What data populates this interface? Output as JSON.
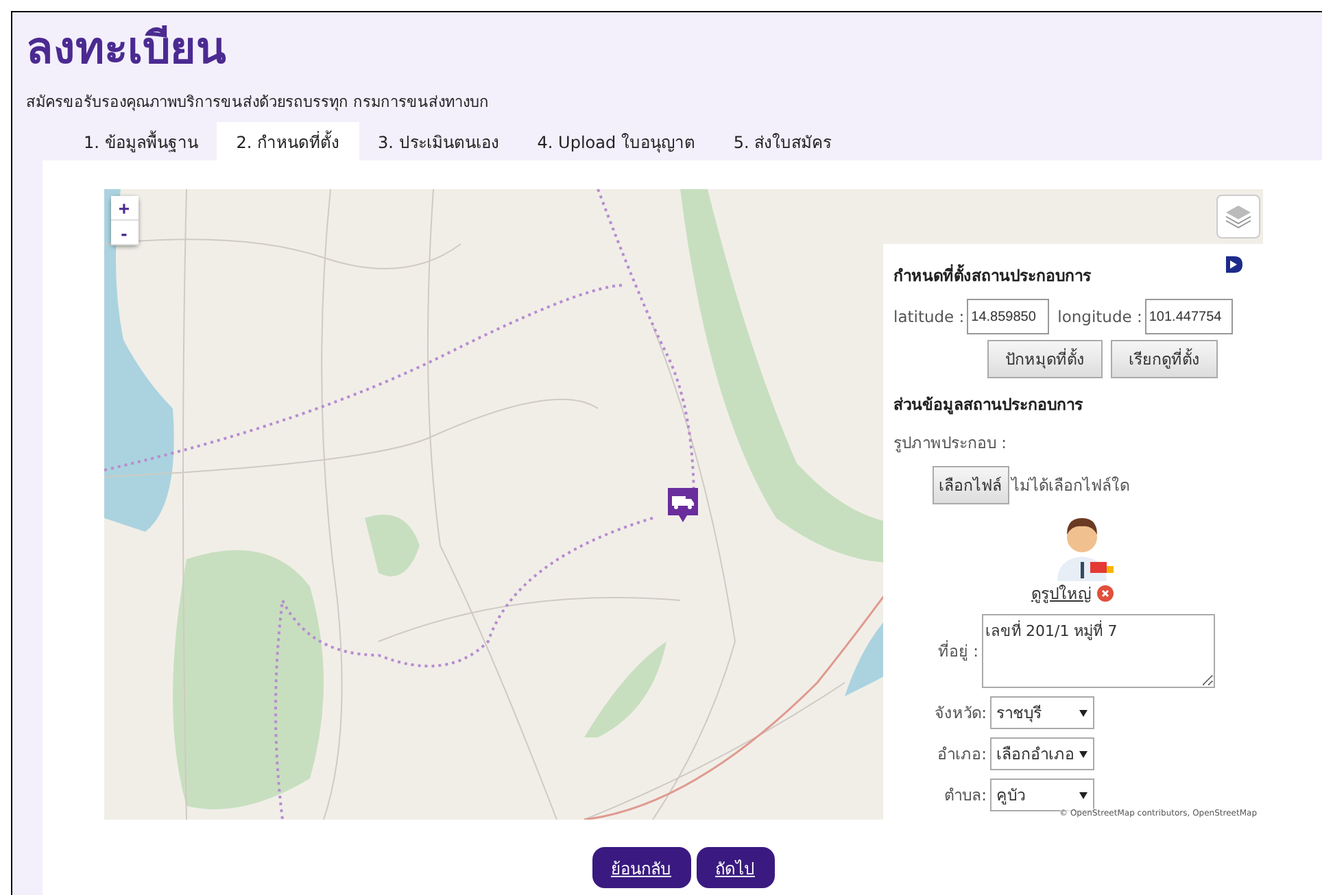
{
  "title": "ลงทะเบียน",
  "subtitle": "สมัครขอรับรองคุณภาพบริการขนส่งด้วยรถบรรทุก กรมการขนส่งทางบก",
  "tabs": [
    {
      "label": "1. ข้อมูลพื้นฐาน",
      "selected": false
    },
    {
      "label": "2. กำหนดที่ตั้ง",
      "selected": true
    },
    {
      "label": "3. ประเมินตนเอง",
      "selected": false
    },
    {
      "label": "4. Upload ใบอนุญาต",
      "selected": false
    },
    {
      "label": "5. ส่งใบสมัคร",
      "selected": false
    }
  ],
  "map": {
    "zoom_in": "+",
    "zoom_out": "-",
    "attribution": "© OpenStreetMap contributors, OpenStreetMap"
  },
  "panel": {
    "heading": "กำหนดที่ตั้งสถานประกอบการ",
    "latitude": {
      "label": "latitude :",
      "value": "14.859850"
    },
    "longitude": {
      "label": "longitude :",
      "value": "101.447754"
    },
    "buttons": [
      "ปักหมุดที่ตั้ง",
      "เรียกดูที่ตั้ง"
    ],
    "section_heading": "ส่วนข้อมูลสถานประกอบการ",
    "photo_label": "รูปภาพประกอบ :",
    "file_button": "เลือกไฟล์",
    "file_status": "ไม่ได้เลือกไฟล์ใด",
    "view_large_link": "ดูรูปใหญ่",
    "address": {
      "label": "ที่อยู่ :",
      "value": "เลขที่ 201/1 หมู่ที่ 7"
    },
    "selects": [
      {
        "label": "จังหวัด:",
        "value": "ราชบุรี"
      },
      {
        "label": "อำเภอ:",
        "value": "เลือกอำเภอ"
      },
      {
        "label": "ตำบล:",
        "value": "คูบัว"
      }
    ]
  },
  "nav_buttons": [
    "ย้อนกลับ",
    "ถัดไป"
  ]
}
